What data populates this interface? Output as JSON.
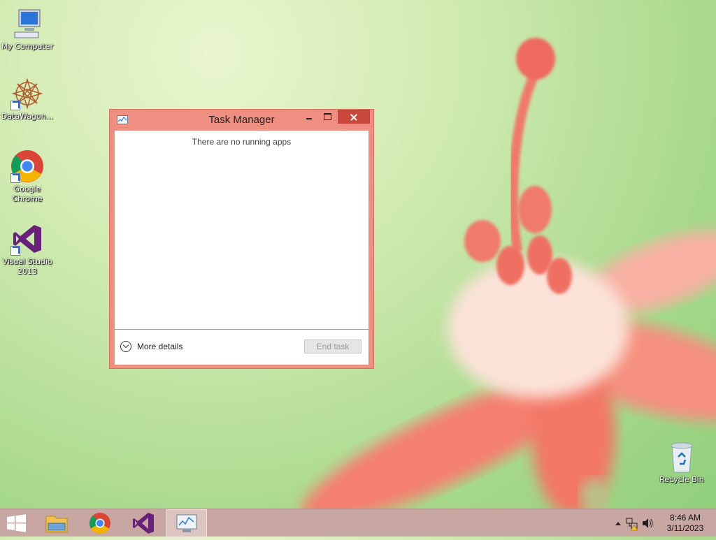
{
  "desktop": {
    "icons": [
      {
        "label": "My Computer",
        "icon": "computer-icon"
      },
      {
        "label": "DataWagon...",
        "icon": "datawagon-icon"
      },
      {
        "label": "Google Chrome",
        "icon": "chrome-icon"
      },
      {
        "label": "Visual Studio 2013",
        "icon": "visual-studio-icon"
      },
      {
        "label": "Recycle Bin",
        "icon": "recycle-bin-icon"
      }
    ]
  },
  "window": {
    "title": "Task Manager",
    "empty_message": "There are no running apps",
    "more_details_label": "More details",
    "end_task_label": "End task",
    "accent_color": "#ef8f82",
    "close_color": "#c9473c"
  },
  "taskbar": {
    "items": [
      {
        "name": "start-button",
        "icon": "windows-logo-icon"
      },
      {
        "name": "file-explorer",
        "icon": "folder-icon"
      },
      {
        "name": "google-chrome",
        "icon": "chrome-icon"
      },
      {
        "name": "visual-studio",
        "icon": "visual-studio-icon"
      },
      {
        "name": "task-manager",
        "icon": "task-manager-icon",
        "active": true
      }
    ],
    "clock": {
      "time": "8:46 AM",
      "date": "3/11/2023"
    },
    "tray_icons": [
      "show-hidden-icons-icon",
      "network-icon",
      "volume-icon"
    ]
  }
}
